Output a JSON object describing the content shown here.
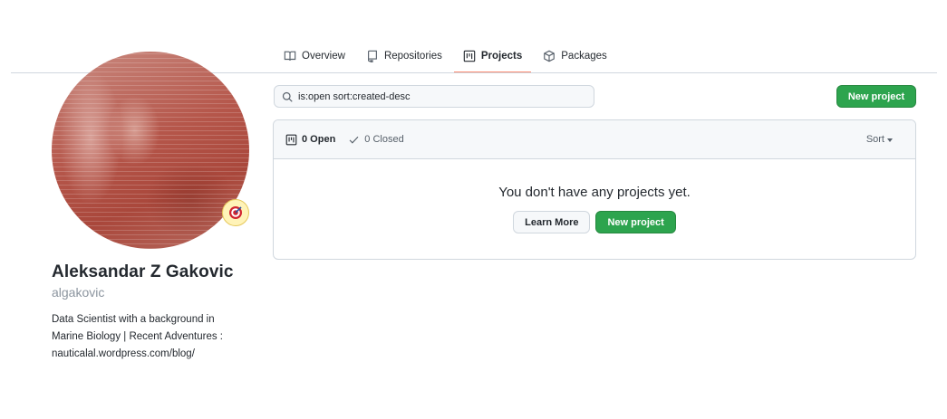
{
  "nav": {
    "tabs": [
      {
        "label": "Overview",
        "icon": "book-icon"
      },
      {
        "label": "Repositories",
        "icon": "repo-icon"
      },
      {
        "label": "Projects",
        "icon": "project-icon",
        "active": true
      },
      {
        "label": "Packages",
        "icon": "package-icon"
      }
    ]
  },
  "profile": {
    "full_name": "Aleksandar Z Gakovic",
    "username": "algakovic",
    "bio_lines": [
      "Data Scientist with a background in",
      "Marine Biology | Recent Adventures :",
      "nauticalal.wordpress.com/blog/"
    ],
    "status_icon": "target-icon"
  },
  "search": {
    "value": "is:open sort:created-desc"
  },
  "toolbar": {
    "new_project_label": "New project"
  },
  "projects": {
    "open_label": "0 Open",
    "closed_label": "0 Closed",
    "sort_label": "Sort",
    "empty_title": "You don't have any projects yet.",
    "learn_more_label": "Learn More",
    "new_project_label": "New project"
  },
  "colors": {
    "accent_green": "#2da44e",
    "active_tab_underline": "#fd8c73",
    "border": "#d0d7de"
  }
}
